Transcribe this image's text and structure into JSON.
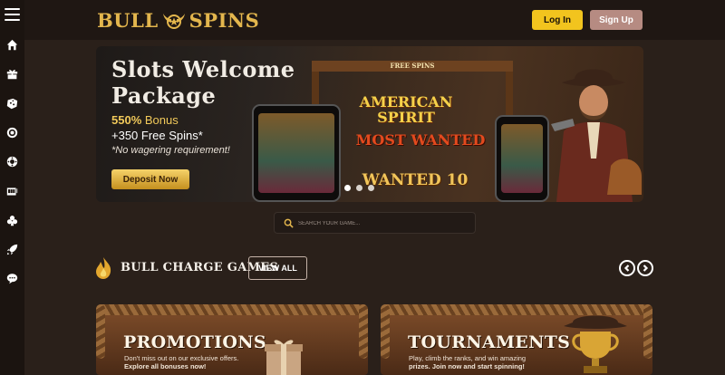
{
  "sidebar": {
    "menu_icon": "hamburger-icon",
    "items": [
      {
        "icon": "home-icon"
      },
      {
        "icon": "gift-icon"
      },
      {
        "icon": "dice-icon"
      },
      {
        "icon": "target-icon"
      },
      {
        "icon": "roulette-icon"
      },
      {
        "icon": "slots-icon"
      },
      {
        "icon": "cards-icon"
      },
      {
        "icon": "rocket-icon"
      },
      {
        "icon": "chat-icon"
      }
    ]
  },
  "header": {
    "logo_left": "BULL",
    "logo_right": "SPINS",
    "login_label": "Log In",
    "signup_label": "Sign Up"
  },
  "banner": {
    "title_line1": "Slots Welcome",
    "title_line2": "Package",
    "bonus_value": "550%",
    "bonus_text": " Bonus",
    "spins_text": "+350 Free Spins*",
    "wager_text": "*No wagering requirement!",
    "cta_label": "Deposit Now",
    "sign_freespins": "FREE SPINS",
    "game1": "AMERICAN SPIRIT",
    "game2": "MOST WANTED",
    "game3": "WANTED 10",
    "slide_count": 3,
    "active_slide": 1
  },
  "search": {
    "placeholder": "SEARCH YOUR GAME..."
  },
  "section": {
    "title": "BULL CHARGE GAMES",
    "view_all_label": "VIEW ALL"
  },
  "promos": [
    {
      "title": "PROMOTIONS",
      "desc_line1": "Don't miss out on our exclusive offers.",
      "desc_line2": "Explore all bonuses now!"
    },
    {
      "title": "TOURNAMENTS",
      "desc_line1": "Play, climb the ranks, and win amazing",
      "desc_line2": "prizes. Join now and start spinning!"
    }
  ],
  "colors": {
    "accent_gold": "#e3b64d",
    "login_yellow": "#f2c41e",
    "signup_rose": "#b68b82",
    "background": "#2a201a"
  }
}
